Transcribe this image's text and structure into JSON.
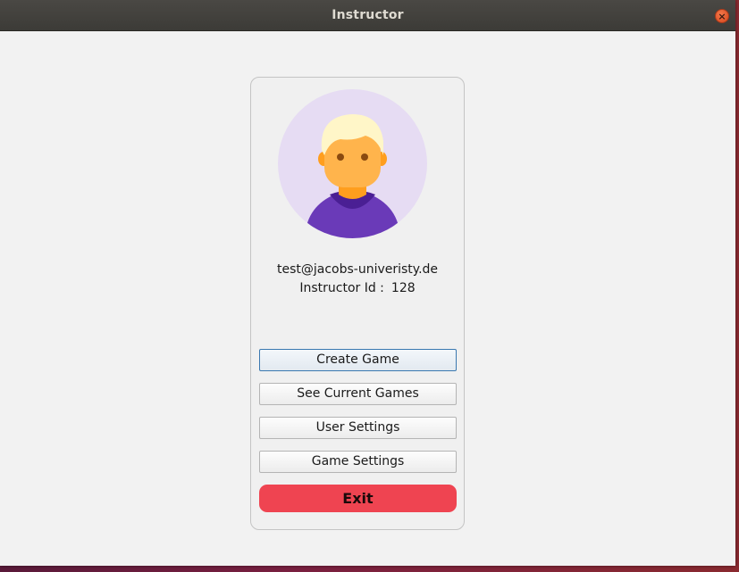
{
  "window": {
    "title": "Instructor",
    "close_glyph": "×"
  },
  "profile": {
    "email": "test@jacobs-univeristy.de",
    "id_label": "Instructor Id :",
    "id_value": "128",
    "avatar_icon": "user-avatar-icon"
  },
  "menu": {
    "create_game": "Create Game",
    "see_current_games": "See Current Games",
    "user_settings": "User Settings",
    "game_settings": "Game Settings",
    "exit": "Exit"
  },
  "colors": {
    "exit_button": "#ef4451",
    "avatar_bg": "#e6dcf3",
    "avatar_shirt": "#6a3ab8",
    "avatar_skin": "#ffb44c",
    "avatar_hair": "#fff6c8",
    "focus_border": "#3a78b0"
  }
}
